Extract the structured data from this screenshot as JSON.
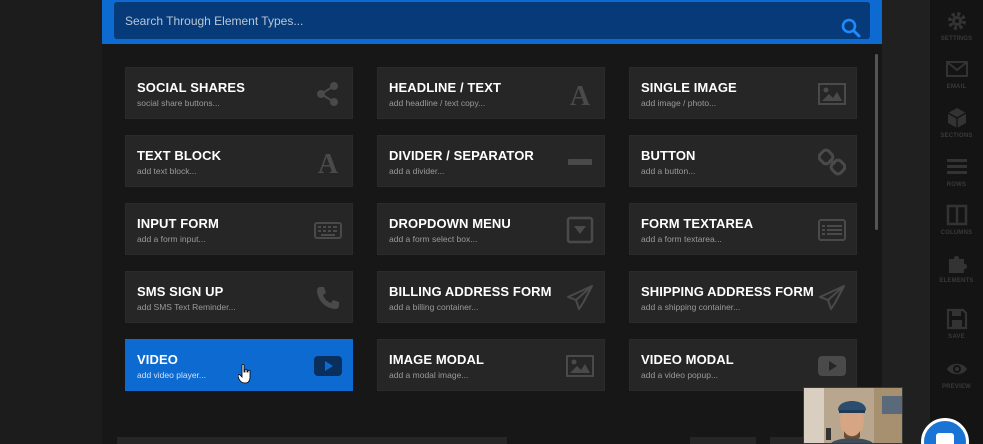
{
  "search": {
    "placeholder": "Search Through Element Types..."
  },
  "elements": [
    {
      "title": "SOCIAL SHARES",
      "subtitle": "social share buttons...",
      "icon": "share-icon",
      "active": false
    },
    {
      "title": "HEADLINE / TEXT",
      "subtitle": "add headline / text copy...",
      "icon": "font-a-icon",
      "active": false
    },
    {
      "title": "SINGLE IMAGE",
      "subtitle": "add image / photo...",
      "icon": "image-icon",
      "active": false
    },
    {
      "title": "TEXT BLOCK",
      "subtitle": "add text block...",
      "icon": "font-a-icon",
      "active": false
    },
    {
      "title": "DIVIDER / SEPARATOR",
      "subtitle": "add a divider...",
      "icon": "minus-icon",
      "active": false
    },
    {
      "title": "BUTTON",
      "subtitle": "add a button...",
      "icon": "link-icon",
      "active": false
    },
    {
      "title": "INPUT FORM",
      "subtitle": "add a form input...",
      "icon": "keyboard-icon",
      "active": false
    },
    {
      "title": "DROPDOWN MENU",
      "subtitle": "add a form select box...",
      "icon": "dropdown-icon",
      "active": false
    },
    {
      "title": "FORM TEXTAREA",
      "subtitle": "add a form textarea...",
      "icon": "list-icon",
      "active": false
    },
    {
      "title": "SMS SIGN UP",
      "subtitle": "add SMS Text Reminder...",
      "icon": "phone-icon",
      "active": false
    },
    {
      "title": "BILLING ADDRESS FORM",
      "subtitle": "add a billing container...",
      "icon": "paper-plane-icon",
      "active": false
    },
    {
      "title": "SHIPPING ADDRESS FORM",
      "subtitle": "add a shipping container...",
      "icon": "paper-plane-icon",
      "active": false
    },
    {
      "title": "VIDEO",
      "subtitle": "add video player...",
      "icon": "play-icon",
      "active": true
    },
    {
      "title": "IMAGE MODAL",
      "subtitle": "add a modal image...",
      "icon": "image-icon",
      "active": false
    },
    {
      "title": "VIDEO MODAL",
      "subtitle": "add a video popup...",
      "icon": "play-icon",
      "active": false
    }
  ],
  "sidebar": [
    {
      "label": "SETTINGS",
      "icon": "gear-icon"
    },
    {
      "label": "EMAIL",
      "icon": "envelope-icon"
    },
    {
      "label": "SECTIONS",
      "icon": "cube-icon"
    },
    {
      "label": "ROWS",
      "icon": "rows-icon"
    },
    {
      "label": "COLUMNS",
      "icon": "columns-icon"
    },
    {
      "label": "ELEMENTS",
      "icon": "puzzle-icon"
    },
    {
      "label": "SAVE",
      "icon": "floppy-icon"
    },
    {
      "label": "PREVIEW",
      "icon": "eye-icon"
    }
  ],
  "colors": {
    "accent": "#0d6ad1",
    "card": "#262626",
    "background": "#171717"
  }
}
